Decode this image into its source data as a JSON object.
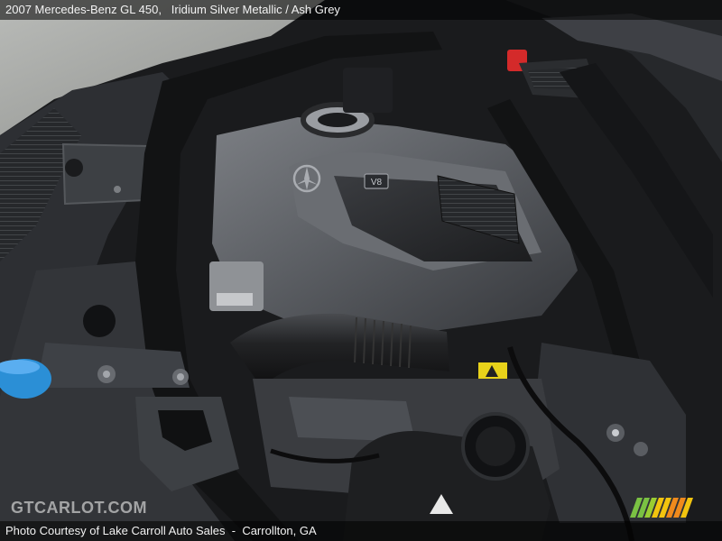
{
  "caption": {
    "model": "2007 Mercedes-Benz GL 450",
    "sep1": ",   ",
    "color": "Iridium Silver Metallic",
    "sep2": " / ",
    "interior": "Ash Grey"
  },
  "footer": {
    "credit": "Photo Courtesy of Lake Carroll Auto Sales",
    "sep": "  -  ",
    "location": "Carrollton, GA"
  },
  "watermark": "GTCARLOT.COM",
  "engine_cover_badge": "V8",
  "colors": {
    "stripe_green": "#7ac143",
    "stripe_yellow": "#f2c40f",
    "stripe_orange": "#f08a1c",
    "coolant_cap": "#2b8fd6",
    "terminal_red": "#d42a2a",
    "warning_label": "#e8d21a"
  }
}
